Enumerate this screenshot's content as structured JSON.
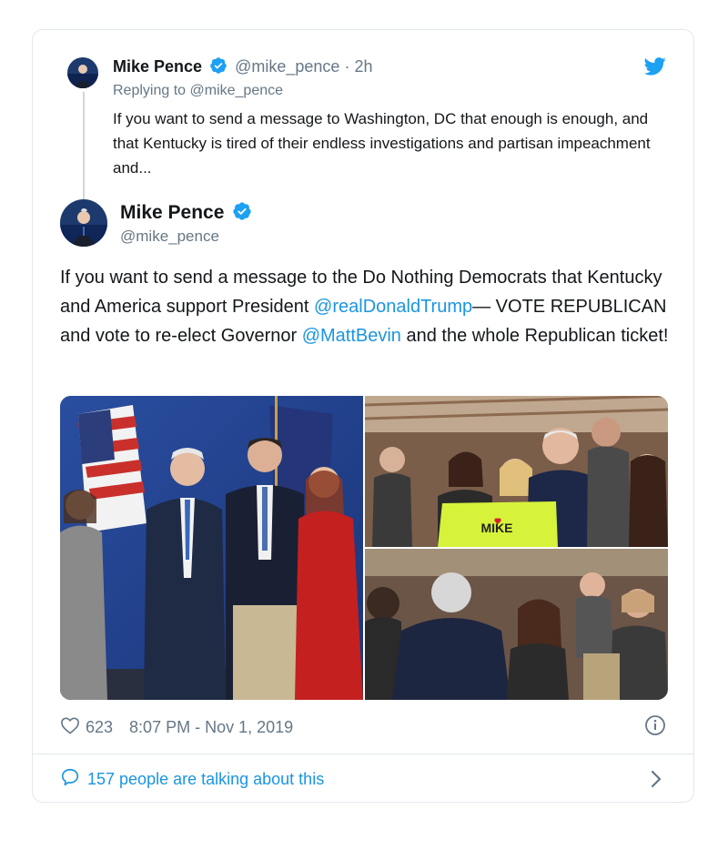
{
  "reply": {
    "name": "Mike Pence",
    "handle": "@mike_pence",
    "time": "· 2h",
    "replying_prefix": "Replying to",
    "replying_to": "@mike_pence",
    "text": "If you want to send a message to Washington, DC that enough is enough, and that Kentucky is tired of their endless investigations and partisan impeachment and..."
  },
  "tweet": {
    "name": "Mike Pence",
    "handle": "@mike_pence",
    "text_1": "If you want to send a message to the Do Nothing Democrats that Kentucky and America support President ",
    "mention_1": "@realDonaldTrump",
    "text_2": "— VOTE REPUBLICAN and vote to re-elect Governor ",
    "mention_2": "@MattBevin",
    "text_3": " and the whole Republican ticket!"
  },
  "footer": {
    "likes": "623",
    "timestamp": "8:07 PM - Nov 1, 2019",
    "talking": "157 people are talking about this"
  },
  "photos": {
    "shirt_text": "MIKE"
  },
  "colors": {
    "twitter_blue": "#1da1f2",
    "link_blue": "#1b95e0",
    "secondary": "#657786",
    "border": "#e1e8ed"
  },
  "icons": [
    "twitter-bird-icon",
    "verified-badge-icon",
    "heart-icon",
    "info-icon",
    "speech-bubble-icon",
    "chevron-right-icon"
  ]
}
